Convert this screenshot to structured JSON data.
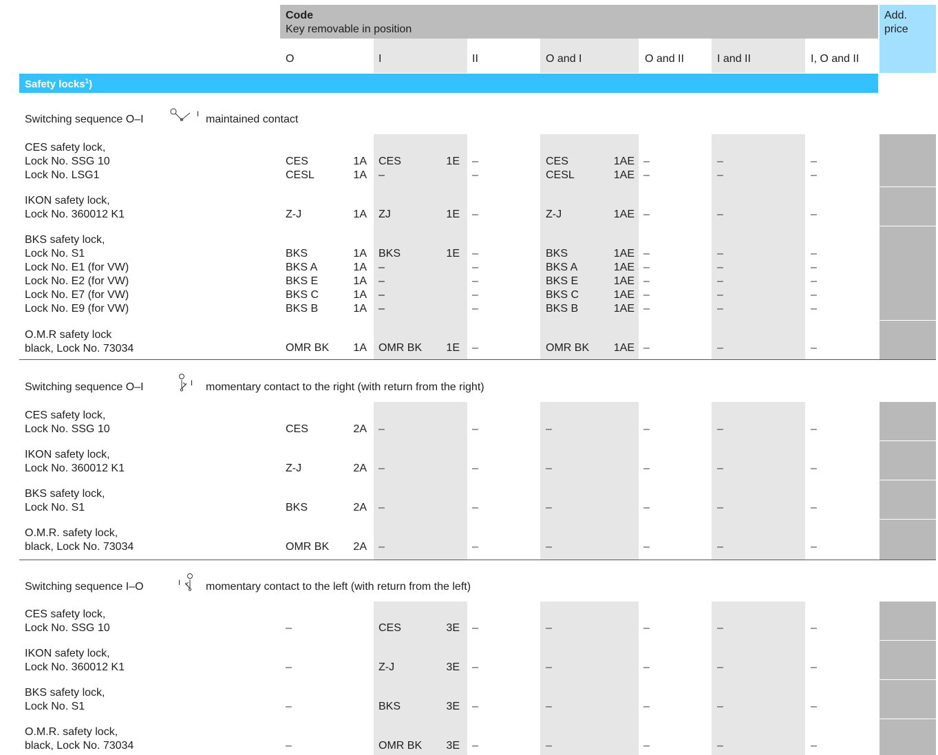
{
  "header": {
    "code_label": "Code",
    "key_removable_label": "Key removable in position",
    "add_price_label": "Add.\nprice",
    "columns": [
      "O",
      "I",
      "II",
      "O and I",
      "O and II",
      "I and II",
      "I, O and II"
    ]
  },
  "section_title": "Safety locks",
  "section_sup": "1",
  "section_suffix": ")",
  "groups": [
    {
      "seq_prefix": "Switching sequence O–I",
      "seq_symbol_left": "",
      "seq_symbol_right": "I",
      "seq_suffix": "maintained contact",
      "rows": [
        {
          "desc": "CES safety lock,\nLock No. SSG 10\nLock No. LSG1",
          "o_name": "CES\nCESL",
          "o_code": "1A\n1A",
          "i_name": "CES\n–",
          "i_code": "1E\n",
          "ii": "–\n–",
          "oi_name": "CES\nCESL",
          "oi_code": "1AE\n1AE",
          "oii": "–\n–",
          "iii": "–\n–",
          "ioii": "–\n–"
        },
        {
          "desc": "IKON safety lock,\nLock No. 360012 K1",
          "o_name": "Z-J",
          "o_code": "1A",
          "i_name": "ZJ",
          "i_code": "1E",
          "ii": "–",
          "oi_name": "Z-J",
          "oi_code": "1AE",
          "oii": "–",
          "iii": "–",
          "ioii": "–"
        },
        {
          "desc": "BKS safety lock,\nLock No. S1\nLock No. E1 (for VW)\nLock No. E2 (for VW)\nLock No. E7 (for VW)\nLock No. E9 (for VW)",
          "o_name": "BKS\nBKS A\nBKS E\nBKS C\nBKS B",
          "o_code": "1A\n1A\n1A\n1A\n1A",
          "i_name": "BKS\n–\n–\n–\n–",
          "i_code": "1E\n\n\n\n",
          "ii": "–\n–\n–\n–\n–",
          "oi_name": "BKS\nBKS A\nBKS E\nBKS C\nBKS B",
          "oi_code": "1AE\n1AE\n1AE\n1AE\n1AE",
          "oii": "–\n–\n–\n–\n–",
          "iii": "–\n–\n–\n–\n–",
          "ioii": "–\n–\n–\n–\n–"
        },
        {
          "desc": "O.M.R safety lock\nblack, Lock No. 73034",
          "o_name": "OMR BK",
          "o_code": "1A",
          "i_name": "OMR BK",
          "i_code": "1E",
          "ii": "–",
          "oi_name": "OMR BK",
          "oi_code": "1AE",
          "oii": "–",
          "iii": "–",
          "ioii": "–"
        }
      ]
    },
    {
      "seq_prefix": "Switching sequence O–I",
      "seq_symbol_left": "",
      "seq_symbol_right": "I",
      "seq_suffix": "momentary contact to the right (with return from the right)",
      "rows": [
        {
          "desc": "CES safety lock,\nLock No. SSG 10",
          "o_name": "CES",
          "o_code": "2A",
          "i_name": "–",
          "i_code": "",
          "ii": "–",
          "oi_name": "–",
          "oi_code": "",
          "oii": "–",
          "iii": "–",
          "ioii": "–"
        },
        {
          "desc": "IKON safety lock,\nLock No. 360012 K1",
          "o_name": "Z-J",
          "o_code": "2A",
          "i_name": "–",
          "i_code": "",
          "ii": "–",
          "oi_name": "–",
          "oi_code": "",
          "oii": "–",
          "iii": "–",
          "ioii": "–"
        },
        {
          "desc": "BKS safety lock,\nLock No. S1",
          "o_name": "BKS",
          "o_code": "2A",
          "i_name": "–",
          "i_code": "",
          "ii": "–",
          "oi_name": "–",
          "oi_code": "",
          "oii": "–",
          "iii": "–",
          "ioii": "–"
        },
        {
          "desc": "O.M.R. safety lock,\nblack, Lock No. 73034",
          "o_name": "OMR BK",
          "o_code": "2A",
          "i_name": "–",
          "i_code": "",
          "ii": "–",
          "oi_name": "–",
          "oi_code": "",
          "oii": "–",
          "iii": "–",
          "ioii": "–"
        }
      ]
    },
    {
      "seq_prefix": "Switching sequence I–O",
      "seq_symbol_left": "I",
      "seq_symbol_right": "",
      "seq_suffix": "momentary contact to the left (with return from the left)",
      "rows": [
        {
          "desc": "CES safety lock,\nLock No. SSG 10",
          "o_name": "–",
          "o_code": "",
          "i_name": "CES",
          "i_code": "3E",
          "ii": "–",
          "oi_name": "–",
          "oi_code": "",
          "oii": "–",
          "iii": "–",
          "ioii": "–"
        },
        {
          "desc": "IKON safety lock,\nLock No. 360012 K1",
          "o_name": "–",
          "o_code": "",
          "i_name": "Z-J",
          "i_code": "3E",
          "ii": "–",
          "oi_name": "–",
          "oi_code": "",
          "oii": "–",
          "iii": "–",
          "ioii": "–"
        },
        {
          "desc": "BKS safety lock,\nLock No. S1",
          "o_name": "–",
          "o_code": "",
          "i_name": "BKS",
          "i_code": "3E",
          "ii": "–",
          "oi_name": "–",
          "oi_code": "",
          "oii": "–",
          "iii": "–",
          "ioii": "–"
        },
        {
          "desc": "O.M.R. safety lock,\nblack, Lock No. 73034",
          "o_name": "–",
          "o_code": "",
          "i_name": "OMR BK",
          "i_code": "3E",
          "ii": "–",
          "oi_name": "–",
          "oi_code": "",
          "oii": "–",
          "iii": "–",
          "ioii": "–"
        }
      ]
    }
  ],
  "colors": {
    "header_gray": "#bcbcbc",
    "column_gray": "#e6e6e6",
    "price_gray": "#b9b9b9",
    "section_blue": "#33c1ff",
    "price_blue": "#a3e0ff"
  }
}
